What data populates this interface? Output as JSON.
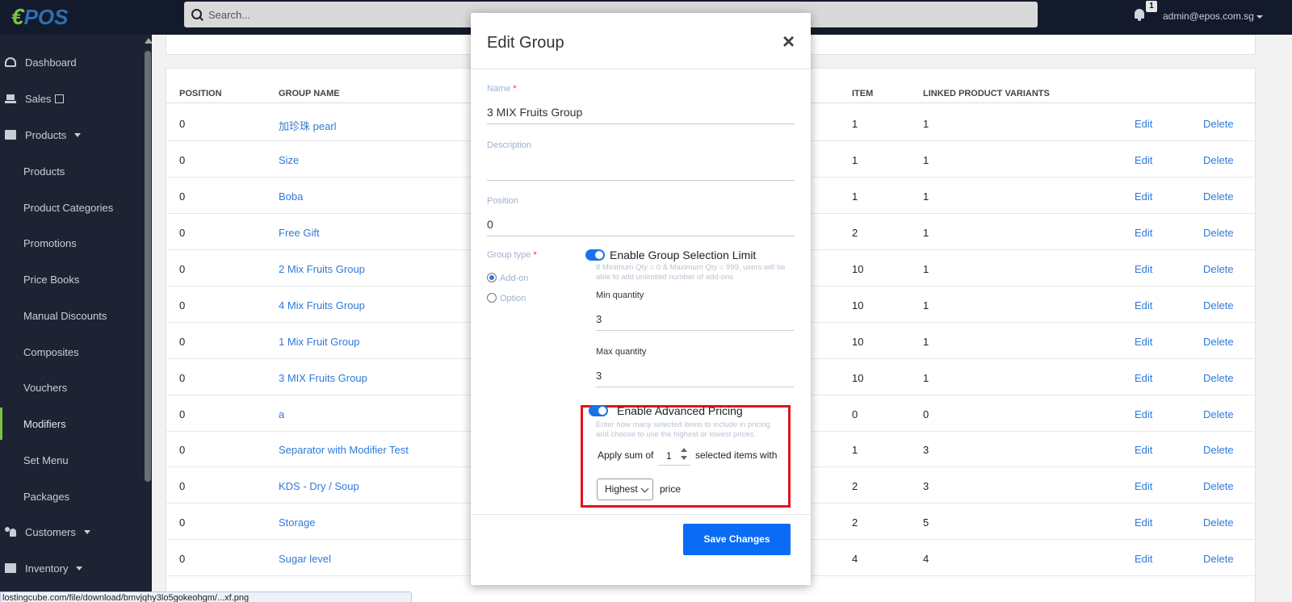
{
  "app": {
    "logo": "POS",
    "search_placeholder": "Search...",
    "notifications_count": "1",
    "user_email": "admin@epos.com.sg"
  },
  "sidebar": {
    "items": [
      {
        "label": "Dashboard",
        "icon": "dashboard-icon"
      },
      {
        "label": "Sales",
        "icon": "cart-icon"
      },
      {
        "label": "Products",
        "icon": "bag-icon"
      },
      {
        "label": "Products"
      },
      {
        "label": "Product Categories"
      },
      {
        "label": "Promotions"
      },
      {
        "label": "Price Books"
      },
      {
        "label": "Manual Discounts"
      },
      {
        "label": "Composites"
      },
      {
        "label": "Vouchers"
      },
      {
        "label": "Modifiers"
      },
      {
        "label": "Set Menu"
      },
      {
        "label": "Packages"
      },
      {
        "label": "Customers",
        "icon": "users-icon"
      },
      {
        "label": "Inventory",
        "icon": "box-icon"
      }
    ]
  },
  "table": {
    "headers": {
      "position": "POSITION",
      "group_name": "GROUP NAME",
      "item": "ITEM",
      "linked": "LINKED PRODUCT VARIANTS"
    },
    "edit_label": "Edit",
    "delete_label": "Delete",
    "rows": [
      {
        "position": "0",
        "name": "加珍珠 pearl",
        "item": "1",
        "linked": "1"
      },
      {
        "position": "0",
        "name": "Size",
        "item": "1",
        "linked": "1"
      },
      {
        "position": "0",
        "name": "Boba",
        "item": "1",
        "linked": "1"
      },
      {
        "position": "0",
        "name": "Free Gift",
        "item": "2",
        "linked": "1"
      },
      {
        "position": "0",
        "name": "2 Mix Fruits Group",
        "item": "10",
        "linked": "1"
      },
      {
        "position": "0",
        "name": "4 Mix Fruits Group",
        "item": "10",
        "linked": "1"
      },
      {
        "position": "0",
        "name": "1 Mix Fruit Group",
        "item": "10",
        "linked": "1"
      },
      {
        "position": "0",
        "name": "3 MIX Fruits Group",
        "item": "10",
        "linked": "1"
      },
      {
        "position": "0",
        "name": "a",
        "item": "0",
        "linked": "0"
      },
      {
        "position": "0",
        "name": "Separator with Modifier Test",
        "item": "1",
        "linked": "3"
      },
      {
        "position": "0",
        "name": "KDS - Dry / Soup",
        "item": "2",
        "linked": "3"
      },
      {
        "position": "0",
        "name": "Storage",
        "item": "2",
        "linked": "5"
      },
      {
        "position": "0",
        "name": "Sugar level",
        "item": "4",
        "linked": "4"
      }
    ]
  },
  "statusbar": {
    "url": "lostingcube.com/file/download/bmvjqhy3lo5gokeohgm/...xf.png"
  },
  "modal": {
    "title": "Edit Group",
    "close": "×",
    "name_label": "Name",
    "name_value": "3 MIX Fruits Group",
    "description_label": "Description",
    "description_value": "",
    "position_label": "Position",
    "position_value": "0",
    "group_type_label": "Group type",
    "group_type_options": [
      "Add-on",
      "Option"
    ],
    "group_type_selected": "Add-on",
    "selection_limit": {
      "label": "Enable Group Selection Limit",
      "enabled": true,
      "hint": "If Minimum Qty = 0 & Maximum Qty = 999, users will be able to add unlimited number of add-ons",
      "min_label": "Min quantity",
      "min_value": "3",
      "max_label": "Max quantity",
      "max_value": "3"
    },
    "advanced_pricing": {
      "label": "Enable Advanced Pricing",
      "enabled": true,
      "hint": "Enter how many selected items to include in pricing and choose to use the highest or lowest prices.",
      "apply_prefix": "Apply sum of",
      "count": "1",
      "apply_suffix": "selected items with",
      "price_mode": "Highest",
      "price_suffix": "price",
      "highlight_color": "#e0121f"
    },
    "save_label": "Save Changes"
  },
  "colors": {
    "accent": "#0a6cf5",
    "link": "#2f7ad8",
    "sidebar_bg": "#1d2333",
    "topbar_bg": "#131a2b",
    "active_marker": "#7cc242"
  }
}
